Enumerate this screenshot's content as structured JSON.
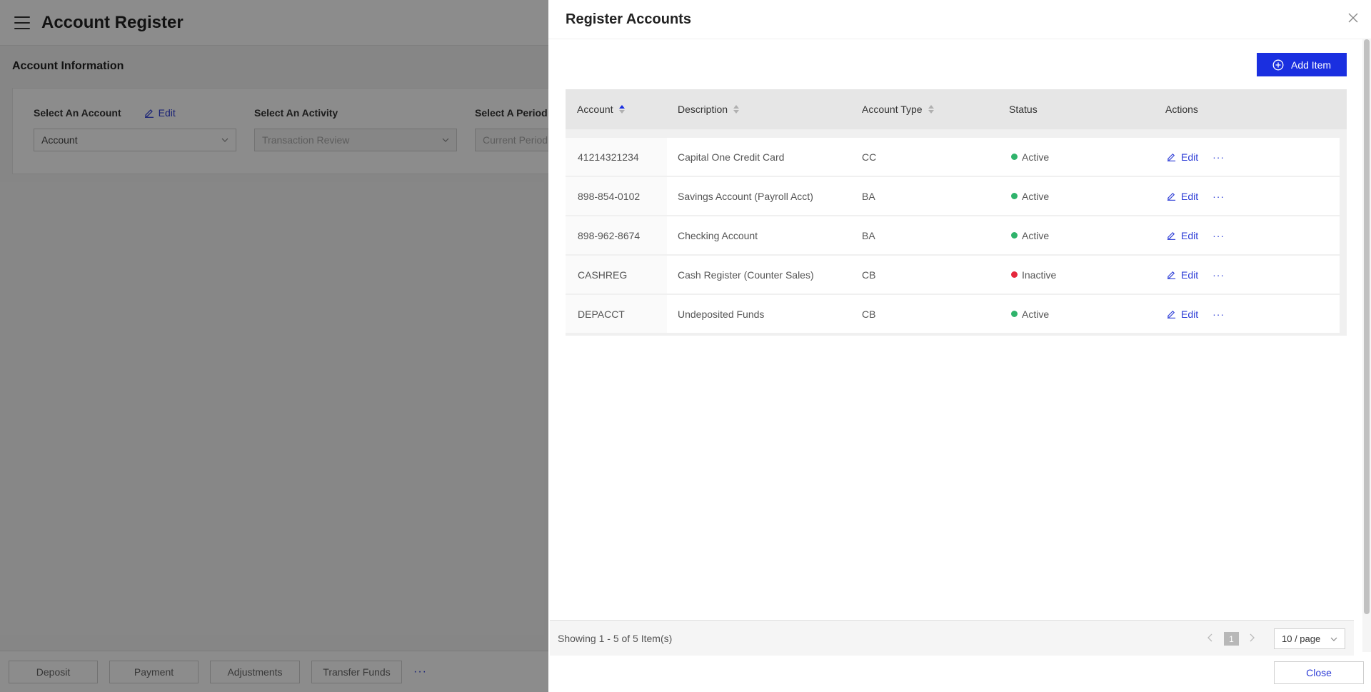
{
  "app": {
    "title": "Account Register"
  },
  "account_info": {
    "section_title": "Account Information",
    "fields": [
      {
        "label": "Select An Account",
        "edit_label": "Edit",
        "value": "Account"
      },
      {
        "label": "Select An Activity",
        "value": "Transaction Review"
      },
      {
        "label": "Select A Period",
        "value": "Current Period"
      }
    ]
  },
  "bottom_bar": {
    "buttons": [
      "Deposit",
      "Payment",
      "Adjustments",
      "Transfer Funds"
    ],
    "more": "···"
  },
  "drawer": {
    "title": "Register Accounts",
    "add_button": "Add Item",
    "columns": [
      "Account",
      "Description",
      "Account Type",
      "Status",
      "Actions"
    ],
    "rows": [
      {
        "account": "41214321234",
        "description": "Capital One Credit Card",
        "type": "CC",
        "status": "Active",
        "edit": "Edit",
        "more": "···"
      },
      {
        "account": "898-854-0102",
        "description": "Savings Account (Payroll Acct)",
        "type": "BA",
        "status": "Active",
        "edit": "Edit",
        "more": "···"
      },
      {
        "account": "898-962-8674",
        "description": "Checking Account",
        "type": "BA",
        "status": "Active",
        "edit": "Edit",
        "more": "···"
      },
      {
        "account": "CASHREG",
        "description": "Cash Register (Counter Sales)",
        "type": "CB",
        "status": "Inactive",
        "edit": "Edit",
        "more": "···"
      },
      {
        "account": "DEPACCT",
        "description": "Undeposited Funds",
        "type": "CB",
        "status": "Active",
        "edit": "Edit",
        "more": "···"
      }
    ],
    "pagination": {
      "summary": "Showing 1 - 5 of 5 Item(s)",
      "current_page": "1",
      "page_size": "10 / page"
    },
    "close_button": "Close"
  },
  "colors": {
    "accent": "#1a2fe0",
    "link": "#2b3bd6",
    "active": "#2fb36b",
    "inactive": "#e5283c"
  }
}
